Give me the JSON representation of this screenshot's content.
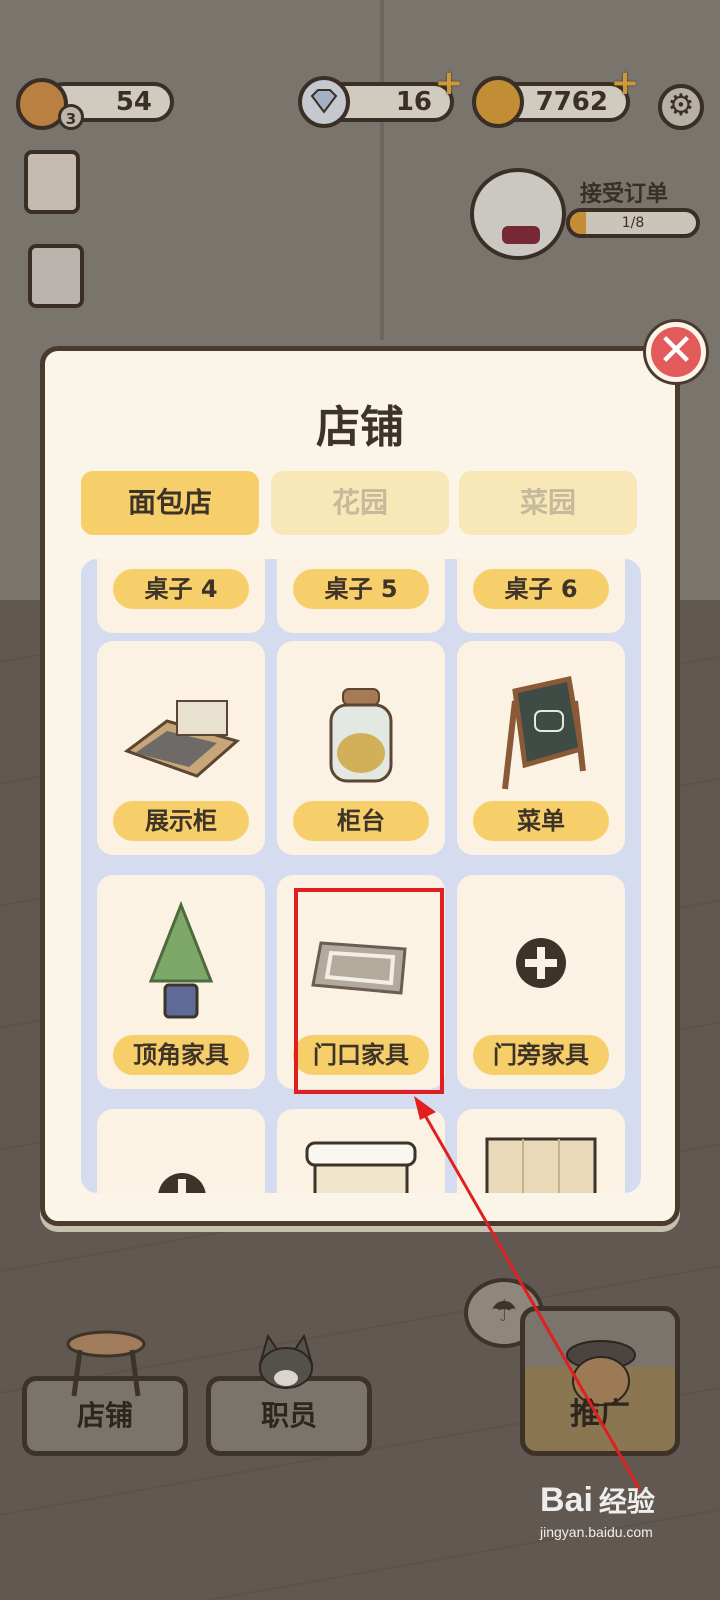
{
  "resources": {
    "level_value": "54",
    "level_badge": "3",
    "diamonds": "16",
    "coins": "7762"
  },
  "order": {
    "label": "接受订单",
    "progress_text": "1/8",
    "progress_fraction": 0.125
  },
  "shop": {
    "title": "店铺",
    "tabs": [
      "面包店",
      "花园",
      "菜园"
    ],
    "active_tab": "面包店",
    "items": [
      {
        "label": "桌子 4"
      },
      {
        "label": "桌子 5"
      },
      {
        "label": "桌子 6"
      },
      {
        "label": "展示柜"
      },
      {
        "label": "柜台"
      },
      {
        "label": "菜单"
      },
      {
        "label": "顶角家具"
      },
      {
        "label": "门口家具"
      },
      {
        "label": "门旁家具"
      }
    ],
    "highlighted_item": "门口家具"
  },
  "bottom_bar": {
    "shop_label": "店铺",
    "staff_label": "职员",
    "promo_label": "推广"
  },
  "watermark": {
    "logo_text": "Bai",
    "logo_suffix": "经验",
    "url": "jingyan.baidu.com"
  },
  "colors": {
    "accent": "#f6cf6a",
    "highlight": "#e02020",
    "close": "#e35a5a"
  }
}
